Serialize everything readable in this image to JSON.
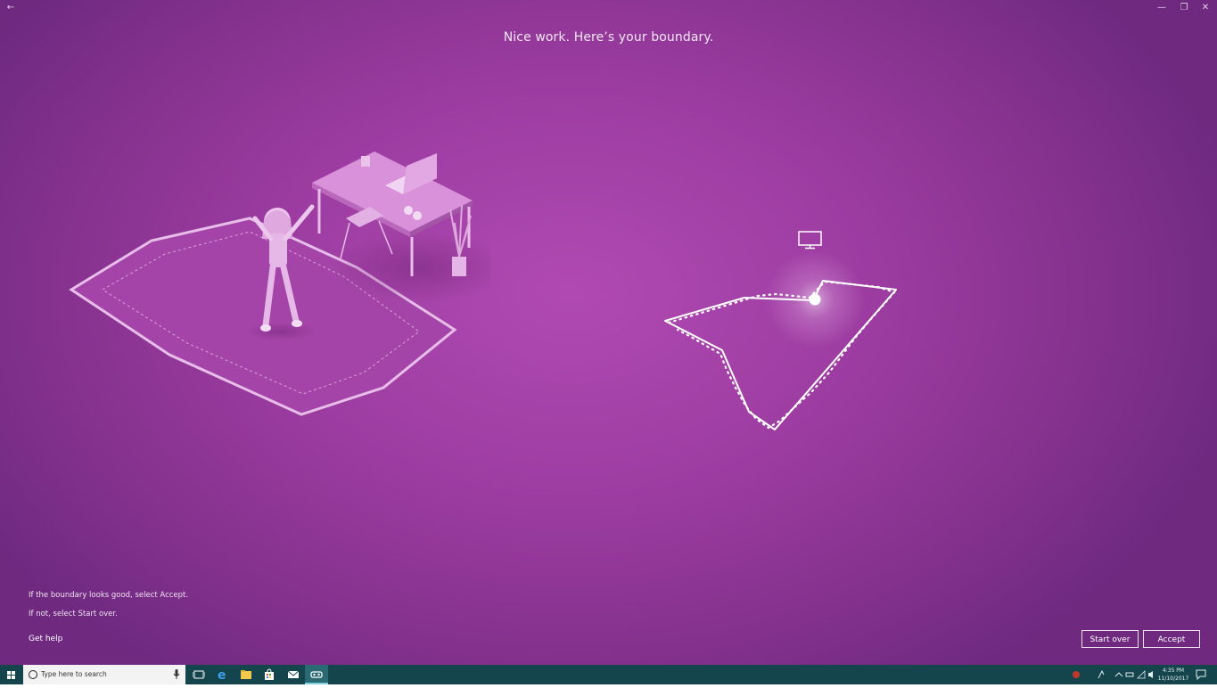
{
  "window": {
    "back_glyph": "←",
    "minimize_glyph": "—",
    "restore_glyph": "❐",
    "close_glyph": "✕"
  },
  "heading": "Nice work. Here’s your boundary.",
  "instructions": {
    "line1": "If the boundary looks good, select Accept.",
    "line2": "If not, select Start over."
  },
  "get_help": "Get help",
  "buttons": {
    "start_over": "Start over",
    "accept": "Accept"
  },
  "taskbar": {
    "search_placeholder": "Type here to search",
    "time": "4:35 PM",
    "date": "11/10/2017",
    "pinned": [
      "task-view",
      "edge",
      "file-explorer",
      "store",
      "mail",
      "mixed-reality-portal"
    ]
  },
  "colors": {
    "background": "#9c3ca1",
    "taskbar": "#14444c",
    "accent": "#ffffff"
  }
}
